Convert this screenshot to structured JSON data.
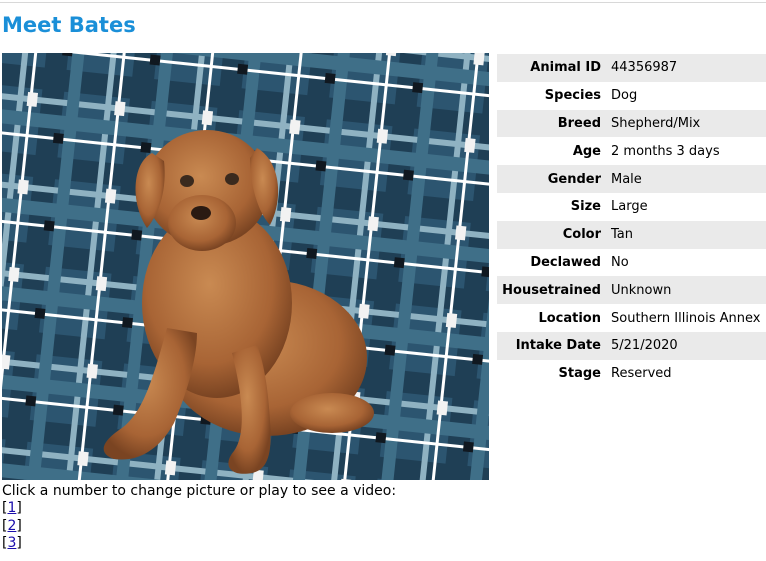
{
  "title": "Meet Bates",
  "details": [
    {
      "label": "Animal ID",
      "value": "44356987"
    },
    {
      "label": "Species",
      "value": "Dog"
    },
    {
      "label": "Breed",
      "value": "Shepherd/Mix"
    },
    {
      "label": "Age",
      "value": "2 months 3 days"
    },
    {
      "label": "Gender",
      "value": "Male"
    },
    {
      "label": "Size",
      "value": "Large"
    },
    {
      "label": "Color",
      "value": "Tan"
    },
    {
      "label": "Declawed",
      "value": "No"
    },
    {
      "label": "Housetrained",
      "value": "Unknown"
    },
    {
      "label": "Location",
      "value": "Southern Illinois Annex"
    },
    {
      "label": "Intake Date",
      "value": "5/21/2020"
    },
    {
      "label": "Stage",
      "value": "Reserved"
    }
  ],
  "caption": "Click a number to change picture or play to see a video:",
  "picture_links": [
    "1",
    "2",
    "3"
  ]
}
